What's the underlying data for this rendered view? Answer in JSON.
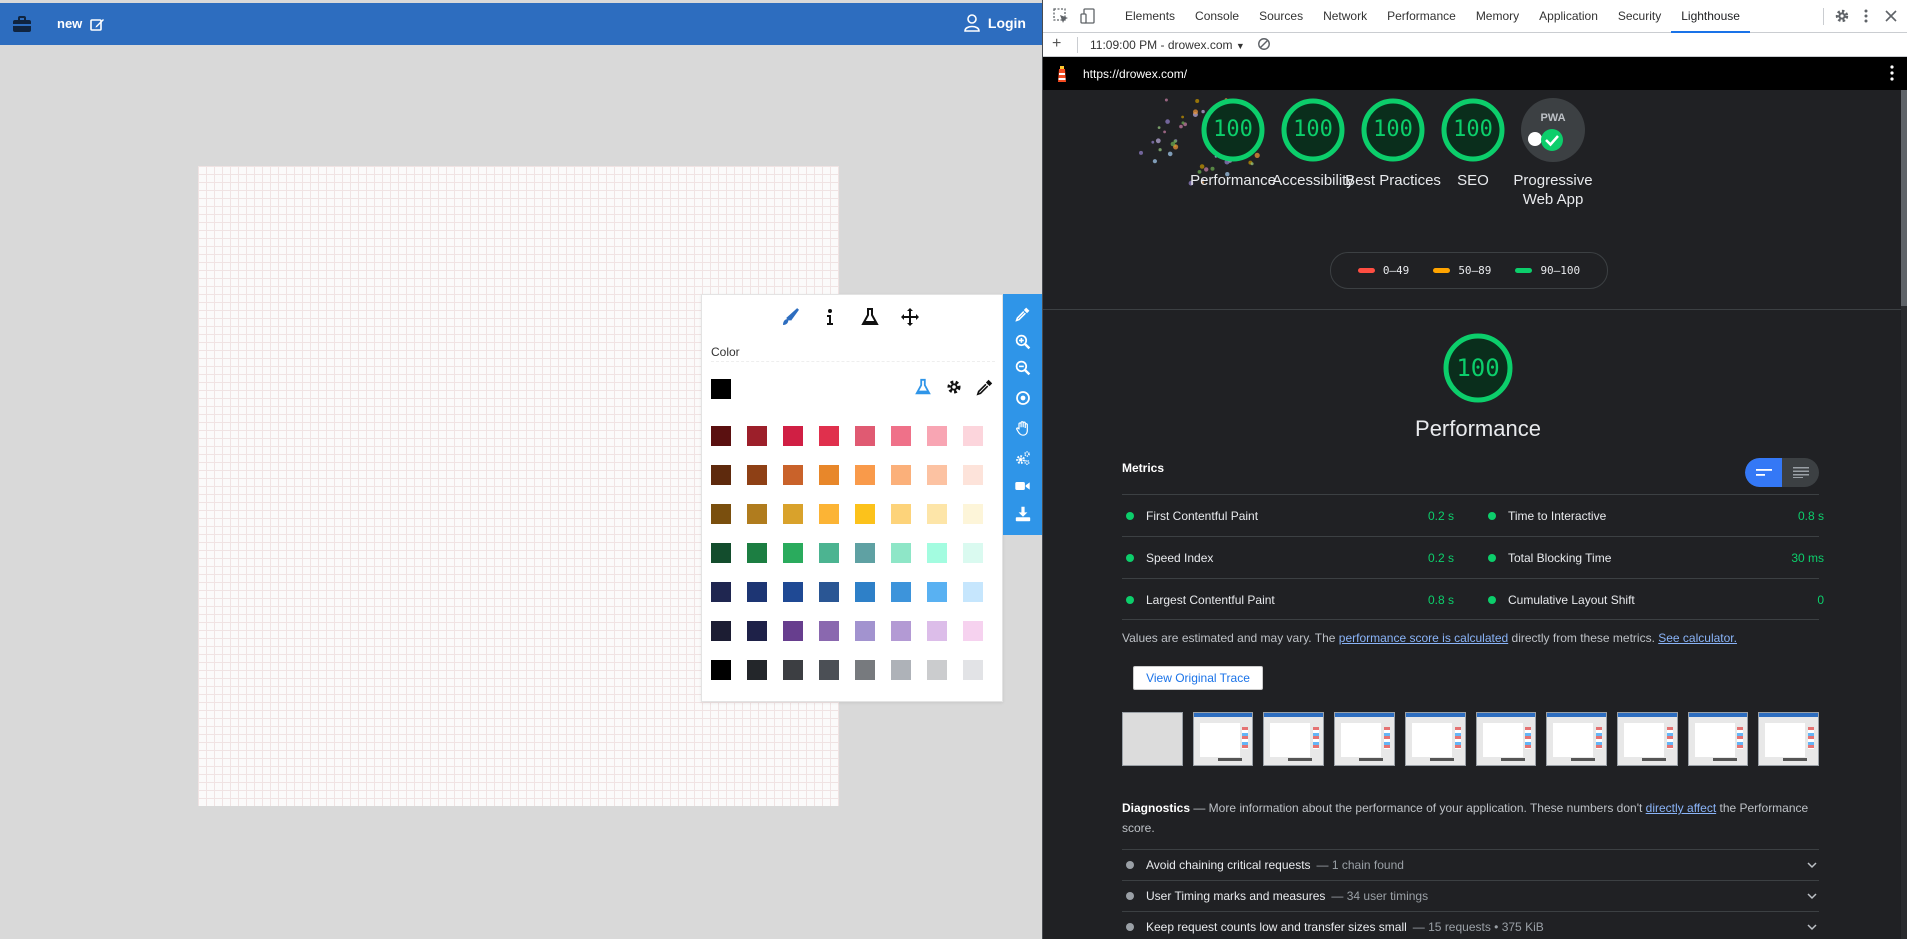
{
  "app": {
    "new_label": "new",
    "login_label": "Login",
    "panel": {
      "color_label": "Color",
      "current_color": "#000000",
      "swatches": [
        "#5a1010",
        "#9c1f2a",
        "#d01f44",
        "#e0304d",
        "#e05a72",
        "#ef7189",
        "#f8a5b3",
        "#fcd5dc",
        "#5e2a0d",
        "#8e4015",
        "#c9622a",
        "#e8872a",
        "#f99a4a",
        "#fbb07a",
        "#fcc2a2",
        "#fde3da",
        "#7a4f0e",
        "#b07c1e",
        "#d9a22b",
        "#fcb435",
        "#fcc21b",
        "#fdd37a",
        "#fde5a8",
        "#fdf5d9",
        "#134d2d",
        "#1c7e42",
        "#2aab5d",
        "#4cb491",
        "#5fa1a3",
        "#8ee6c7",
        "#a3fce0",
        "#dafaf0",
        "#1f2650",
        "#1d3573",
        "#1f4994",
        "#2a5694",
        "#2e80c8",
        "#3d94db",
        "#59b1f2",
        "#c6e6fd",
        "#1c1d33",
        "#1e2148",
        "#673e8e",
        "#8a68af",
        "#a293cf",
        "#b39ad4",
        "#dcbde9",
        "#f6d2ef",
        "#000000",
        "#23262a",
        "#3c3e42",
        "#4b4f55",
        "#777a7e",
        "#aeb2b8",
        "#cbccce",
        "#e2e3e6"
      ]
    }
  },
  "devtools": {
    "tabs": [
      "Elements",
      "Console",
      "Sources",
      "Network",
      "Performance",
      "Memory",
      "Application",
      "Security",
      "Lighthouse"
    ],
    "active_tab": "Lighthouse",
    "report_selector": "11:09:00 PM - drowex.com",
    "url": "https://drowex.com/",
    "gauges": [
      {
        "score": "100",
        "label": "Performance"
      },
      {
        "score": "100",
        "label": "Accessibility"
      },
      {
        "score": "100",
        "label": "Best Practices"
      },
      {
        "score": "100",
        "label": "SEO"
      }
    ],
    "pwa": {
      "badge_text": "PWA",
      "label": "Progressive Web App"
    },
    "legend": [
      {
        "range": "0–49",
        "color": "#ff4e42"
      },
      {
        "range": "50–89",
        "color": "#ffa400"
      },
      {
        "range": "90–100",
        "color": "#0cce6b"
      }
    ],
    "perf_score": "100",
    "perf_title": "Performance",
    "metrics_header": "Metrics",
    "metrics": [
      {
        "name": "First Contentful Paint",
        "value": "0.2 s"
      },
      {
        "name": "Time to Interactive",
        "value": "0.8 s"
      },
      {
        "name": "Speed Index",
        "value": "0.2 s"
      },
      {
        "name": "Total Blocking Time",
        "value": "30 ms"
      },
      {
        "name": "Largest Contentful Paint",
        "value": "0.8 s"
      },
      {
        "name": "Cumulative Layout Shift",
        "value": "0"
      }
    ],
    "note": {
      "prefix": "Values are estimated and may vary. The ",
      "link1": "performance score is calculated",
      "middle": " directly from these metrics. ",
      "link2": "See calculator."
    },
    "view_trace": "View Original Trace",
    "diagnostics": {
      "title": "Diagnostics",
      "text1": " — More information about the performance of your application. These numbers don't ",
      "link": "directly affect",
      "text2": " the Performance score."
    },
    "audits": [
      {
        "title": "Avoid chaining critical requests",
        "detail": "— 1 chain found"
      },
      {
        "title": "User Timing marks and measures",
        "detail": "— 34 user timings"
      },
      {
        "title": "Keep request counts low and transfer sizes small",
        "detail": "— 15 requests • 375 KiB"
      }
    ],
    "colors": {
      "pass": "#0cce6b",
      "accent": "#1a73e8"
    }
  }
}
